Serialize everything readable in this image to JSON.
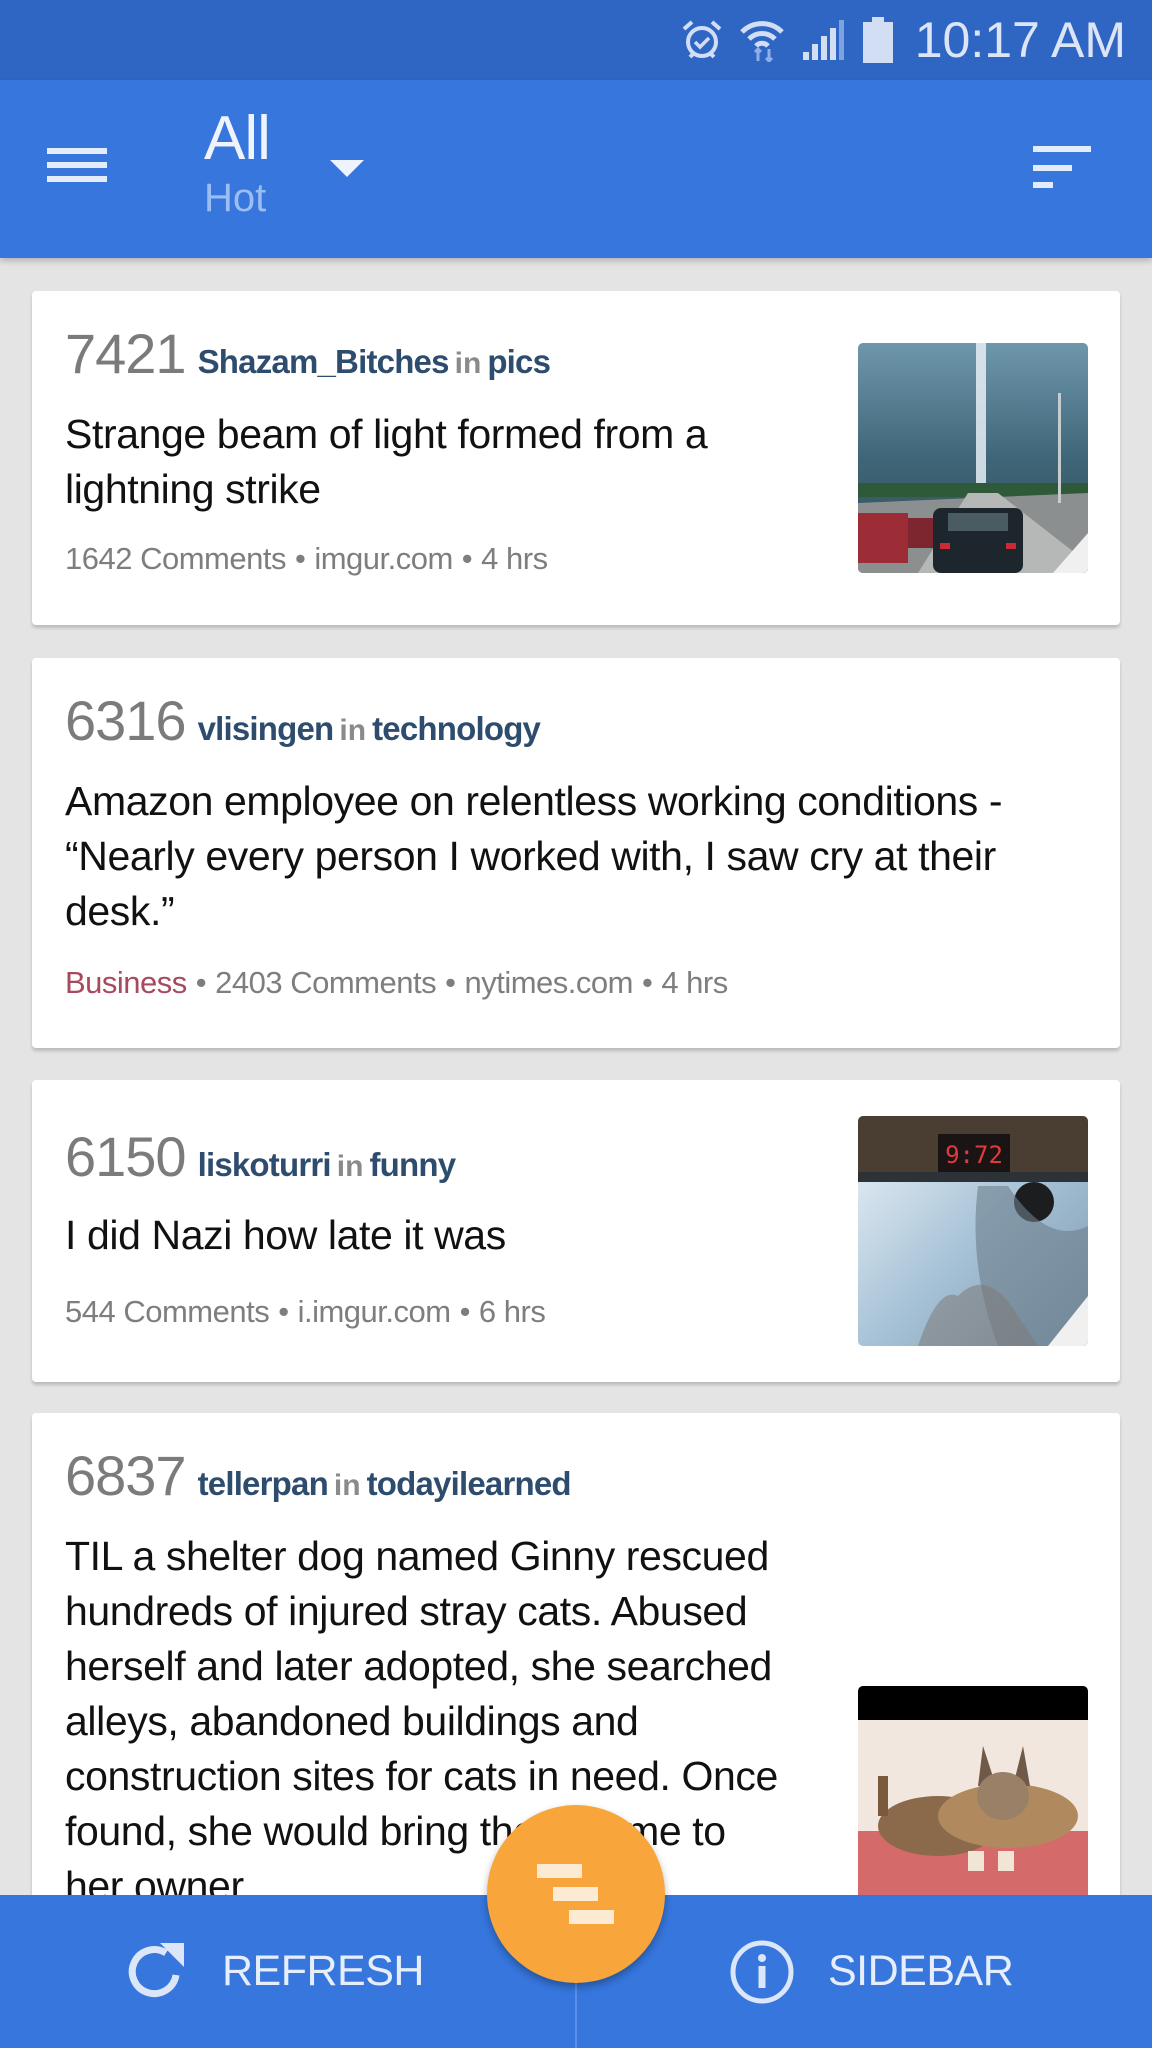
{
  "status_bar": {
    "time": "10:17 AM",
    "icons": [
      "alarm-icon",
      "wifi-icon",
      "signal-icon",
      "battery-icon"
    ]
  },
  "app_bar": {
    "menu_icon": "hamburger-icon",
    "title": "All",
    "subtitle": "Hot",
    "dropdown_icon": "triangle-down-icon",
    "sort_icon": "sort-icon"
  },
  "colors": {
    "primary": "#3676dd",
    "status_bar": "#2f66c4",
    "accent": "#f8a53c",
    "author_link": "#2e4d6e",
    "flair": "#a84a5e",
    "background": "#e4e4e4"
  },
  "posts": [
    {
      "score": "7421",
      "author": "Shazam_Bitches",
      "in_label": "in",
      "subreddit": "pics",
      "title": "Strange beam of light formed from a lightning strike",
      "comments": "1642 Comments",
      "domain": "imgur.com",
      "age": "4 hrs",
      "thumbnail": "storm-lightning-beam-traffic-photo"
    },
    {
      "score": "6316",
      "author": "vlisingen",
      "in_label": "in",
      "subreddit": "technology",
      "title": "Amazon employee on relentless working conditions - “Nearly every person I worked with, I saw cry at their desk.”",
      "flair": "Business",
      "comments": "2403 Comments",
      "domain": "nytimes.com",
      "age": "4 hrs"
    },
    {
      "score": "6150",
      "author": "liskoturri",
      "in_label": "in",
      "subreddit": "funny",
      "title": "I did Nazi how late it was",
      "comments": "544 Comments",
      "domain": "i.imgur.com",
      "age": "6 hrs",
      "thumbnail": "car-clock-9-72-photo",
      "thumbnail_clock_text": "9:72"
    },
    {
      "score": "6837",
      "author": "tellerpan",
      "in_label": "in",
      "subreddit": "todayilearned",
      "title": "TIL a shelter dog named Ginny rescued hundreds of injured stray cats. Abused herself and later adopted, she searched alleys, abandoned buildings and construction sites for cats in need. Once found, she would bring them home to her owner",
      "title_visible_lines": [
        "TIL a shelter dog named Ginny",
        "rescued hundreds of injured stray",
        "cats. Abused herself and later",
        "adopted, she searched alleys,",
        "abandoned buildings and",
        "construction sites for",
        "need.",
        "Once found, she wou",
        "er"
      ],
      "thumbnail": "dog-and-cat-photo"
    }
  ],
  "bottom_bar": {
    "refresh_label": "REFRESH",
    "refresh_icon": "refresh-icon",
    "sidebar_label": "SIDEBAR",
    "sidebar_icon": "info-icon"
  },
  "fab": {
    "icon": "staggered-lines-icon"
  }
}
